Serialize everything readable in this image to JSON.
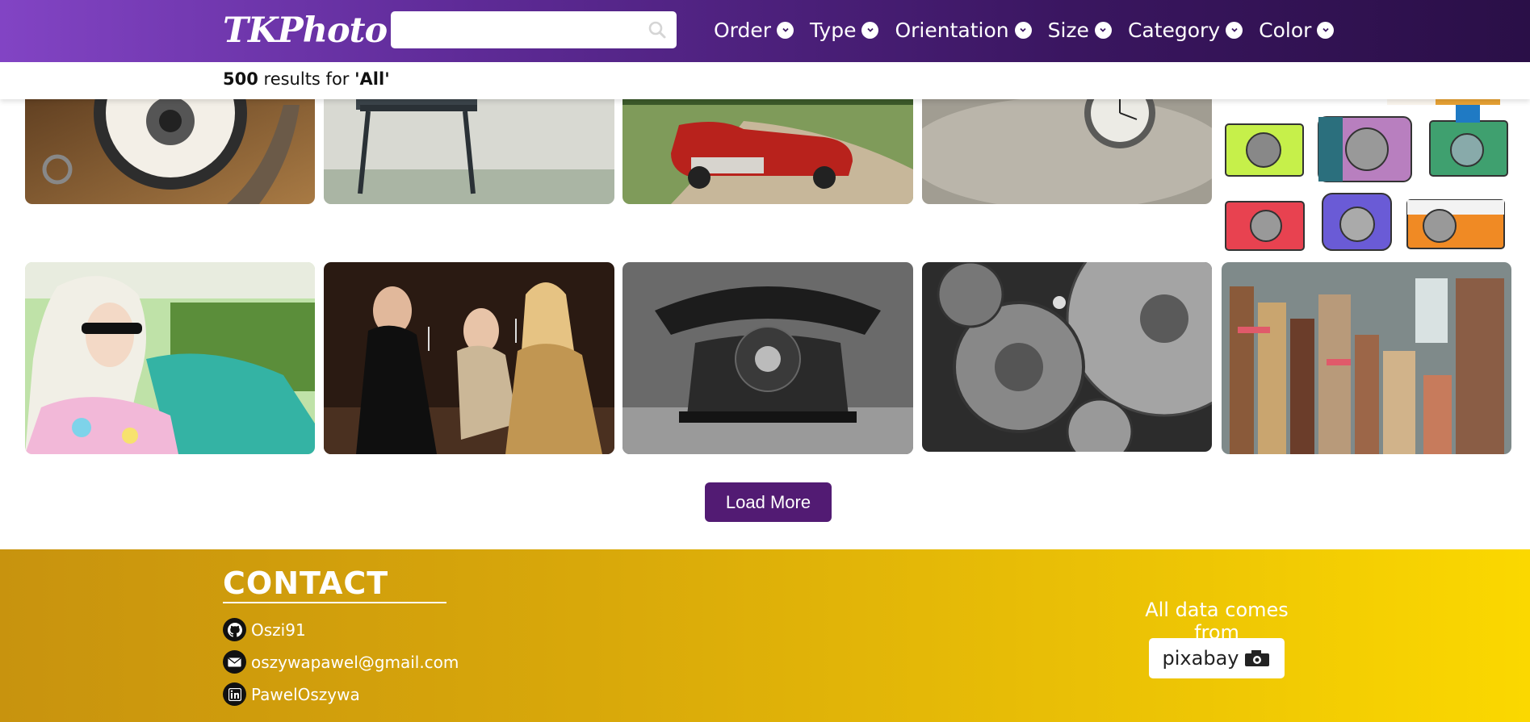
{
  "navbar": {
    "logo": "TKPhoto",
    "search": {
      "value": "",
      "placeholder": "",
      "icon": "search-icon"
    },
    "menu": [
      {
        "label": "Order",
        "icon": "chevron-down-icon"
      },
      {
        "label": "Type",
        "icon": "chevron-down-icon"
      },
      {
        "label": "Orientation",
        "icon": "chevron-down-icon"
      },
      {
        "label": "Size",
        "icon": "chevron-down-icon"
      },
      {
        "label": "Category",
        "icon": "chevron-down-icon"
      },
      {
        "label": "Color",
        "icon": "chevron-down-icon"
      }
    ]
  },
  "results": {
    "count": "500",
    "middle": " results for ",
    "query": "'All'"
  },
  "gallery": {
    "row1": [
      {
        "subject": "pocket watch on wood"
      },
      {
        "subject": "vintage tv stand"
      },
      {
        "subject": "red vintage convertible car"
      },
      {
        "subject": "pocket watch in sand"
      },
      {
        "subject": "colorful camera illustrations"
      }
    ],
    "row2": [
      {
        "subject": "woman in vintage car with headscarf"
      },
      {
        "subject": "three women with wine glasses"
      },
      {
        "subject": "black rotary telephone"
      },
      {
        "subject": "clockwork gears"
      },
      {
        "subject": "stacks of old books"
      }
    ]
  },
  "load_more_label": "Load More",
  "footer": {
    "contact_title": "CONTACT",
    "github": "Oszi91",
    "email": "oszywapawel@gmail.com",
    "linkedin": "PawelOszywa",
    "data_from": "All data comes from",
    "pixabay": "pixabay"
  },
  "colors": {
    "navbar_start": "#8244c4",
    "navbar_end": "#2a0f47",
    "load_more": "#521b73",
    "footer_start": "#c8930e",
    "footer_end": "#fbd800"
  }
}
